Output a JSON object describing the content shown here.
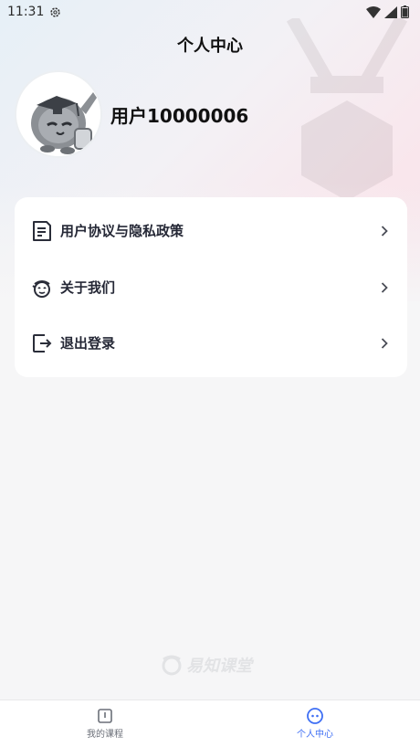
{
  "status_bar": {
    "time": "11:31"
  },
  "header": {
    "title": "个人中心"
  },
  "profile": {
    "username": "用户10000006"
  },
  "menu": [
    {
      "label": "用户协议与隐私政策",
      "icon": "document-icon"
    },
    {
      "label": "关于我们",
      "icon": "mascot-icon"
    },
    {
      "label": "退出登录",
      "icon": "logout-icon"
    }
  ],
  "watermark": {
    "text": "易知课堂"
  },
  "bottom_nav": [
    {
      "label": "我的课程",
      "icon": "book-icon",
      "active": false
    },
    {
      "label": "个人中心",
      "icon": "profile-face-icon",
      "active": true
    }
  ],
  "colors": {
    "accent": "#3f6ff4",
    "text": "#252836"
  }
}
